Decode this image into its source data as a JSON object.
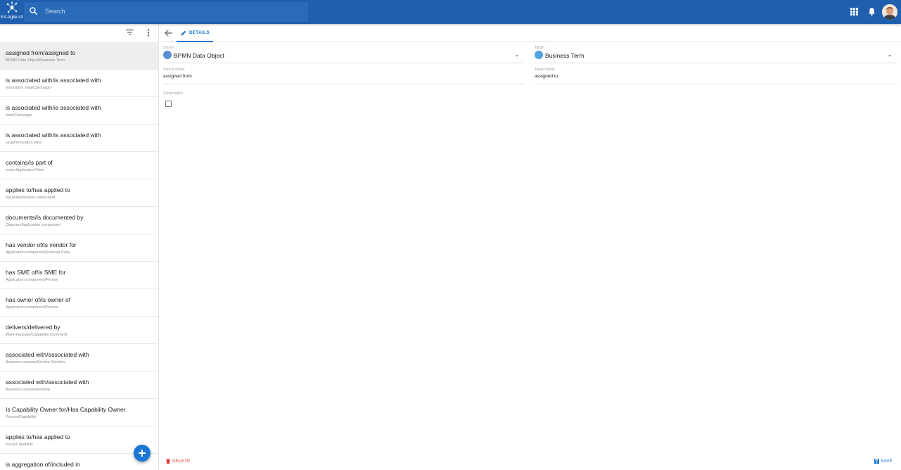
{
  "app": {
    "logo_text": "EA Agile v3",
    "search_placeholder": "Search"
  },
  "sidebar": {
    "items": [
      {
        "title": "assigned from/assigned to",
        "subtitle": "BPMN Data Object/Business Term",
        "selected": true
      },
      {
        "title": "is associated with/is associated with",
        "subtitle": "Innovation Idea/Campaign"
      },
      {
        "title": "is associated with/is associated with",
        "subtitle": "Idea/Campaign"
      },
      {
        "title": "is associated with/is associated with",
        "subtitle": "Goal/Innovation Idea"
      },
      {
        "title": "contains/is part of",
        "subtitle": "erwin Application/View"
      },
      {
        "title": "applies to/has applied to",
        "subtitle": "Issue/Application component"
      },
      {
        "title": "documents/is documented by",
        "subtitle": "Diagram/Application component"
      },
      {
        "title": "has vendor of/is vendor for",
        "subtitle": "Application component/External Party"
      },
      {
        "title": "has SME of/is SME for",
        "subtitle": "Application component/Person"
      },
      {
        "title": "has owner of/is owner of",
        "subtitle": "Application component/Person"
      },
      {
        "title": "delivers/delivered by",
        "subtitle": "Work Package/Capability Increment"
      },
      {
        "title": "associated with/associated with",
        "subtitle": "Business process/Service Solution"
      },
      {
        "title": "associated with/associated with",
        "subtitle": "Business process/Feeling"
      },
      {
        "title": "Is Capability Owner for/Has Capability Owner",
        "subtitle": "Person/Capability"
      },
      {
        "title": "applies to/has applied to",
        "subtitle": "Issue/Capability"
      },
      {
        "title": "is aggregation of/included in",
        "subtitle": ""
      }
    ]
  },
  "main": {
    "tab_label": "DETAILS",
    "source": {
      "label": "Source",
      "value": "BPMN Data Object"
    },
    "target": {
      "label": "Target",
      "value": "Business Term"
    },
    "source_name": {
      "label": "Source Name",
      "value": "assigned from"
    },
    "target_name": {
      "label": "Target Name",
      "value": "assigned to"
    },
    "composition": {
      "label": "Composition",
      "checked": false
    },
    "delete_label": "DELETE",
    "save_label": "SAVE"
  },
  "colors": {
    "header": "#1f5fae",
    "accent": "#1976d2",
    "danger": "#e53935",
    "source_icon": "#5c8fd6",
    "target_icon": "#4fa3e0"
  }
}
